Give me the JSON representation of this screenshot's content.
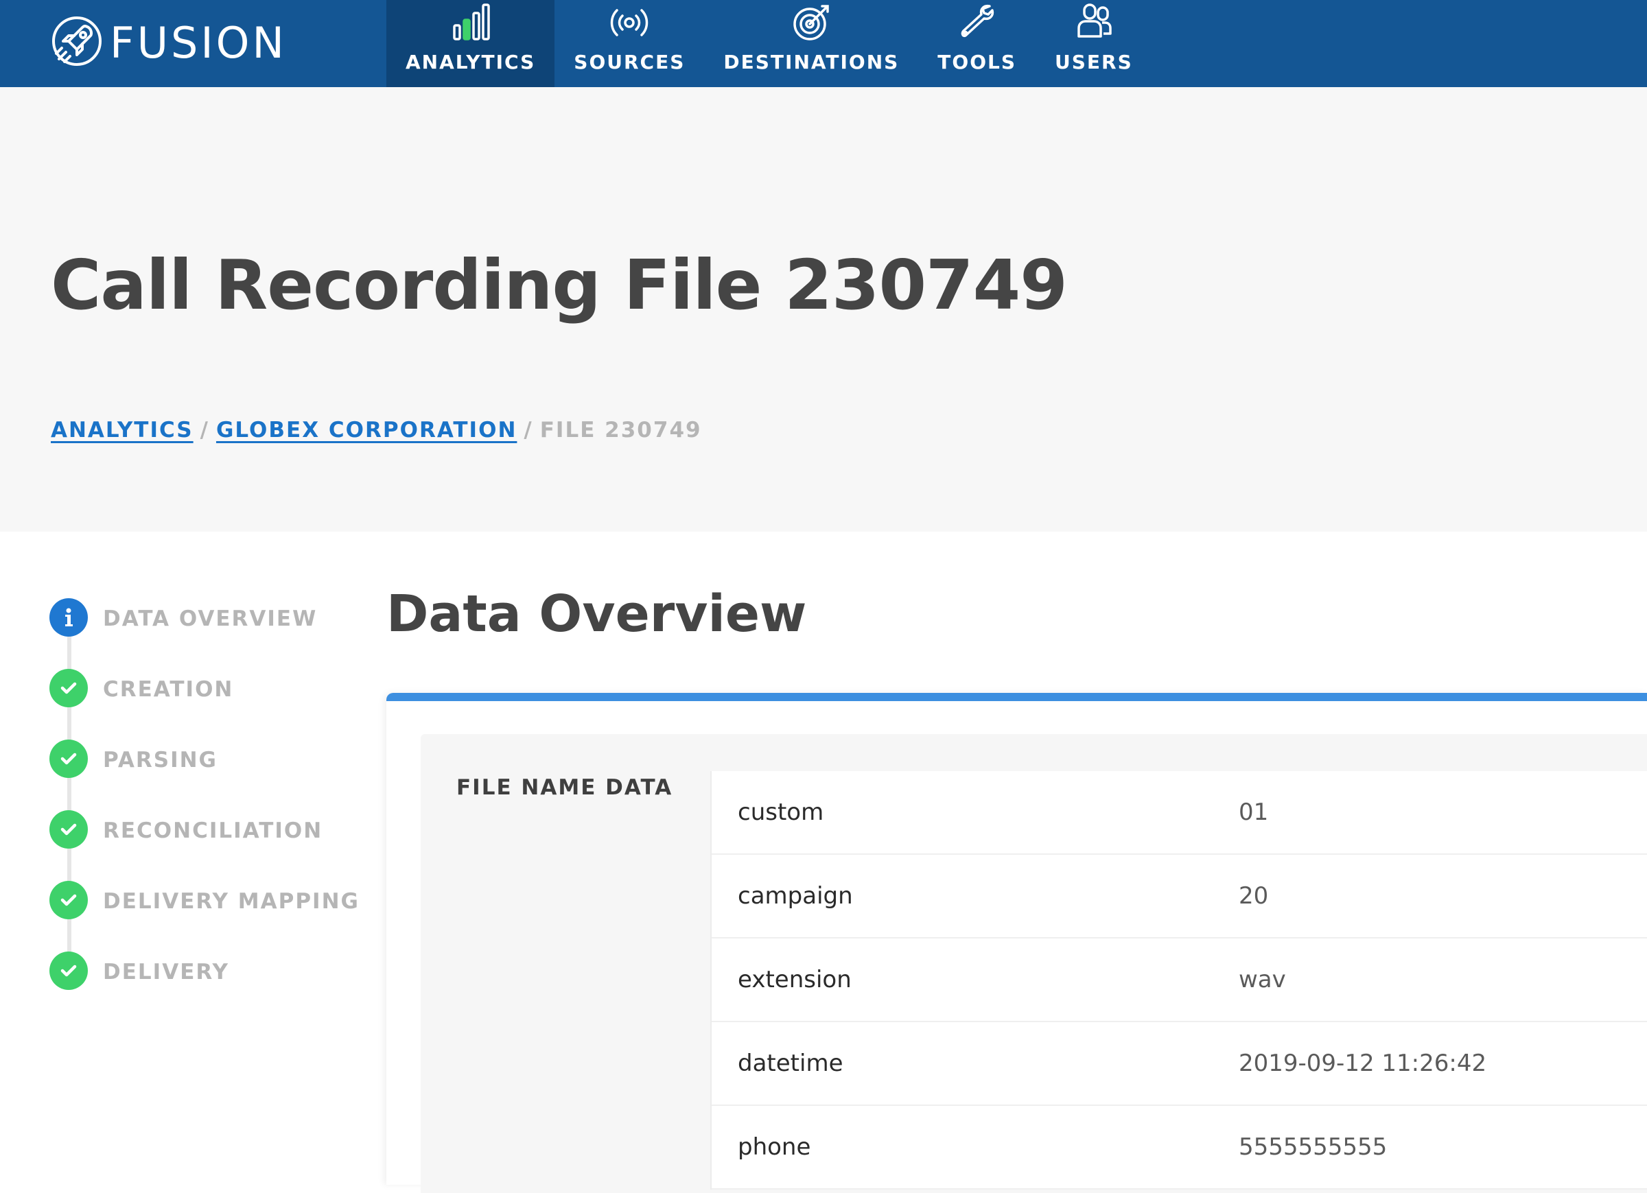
{
  "app": {
    "brand": "FUSION"
  },
  "nav": {
    "items": [
      {
        "label": "ANALYTICS",
        "icon": "bar-chart-icon",
        "active": true
      },
      {
        "label": "SOURCES",
        "icon": "broadcast-icon",
        "active": false
      },
      {
        "label": "DESTINATIONS",
        "icon": "target-icon",
        "active": false
      },
      {
        "label": "TOOLS",
        "icon": "wrench-icon",
        "active": false
      },
      {
        "label": "USERS",
        "icon": "users-icon",
        "active": false
      }
    ]
  },
  "header": {
    "title": "Call Recording File 230749",
    "breadcrumb": {
      "root": "ANALYTICS",
      "parent": "GLOBEX CORPORATION",
      "current": "FILE 230749",
      "separator": "/"
    }
  },
  "steps": [
    {
      "label": "DATA OVERVIEW",
      "status": "info"
    },
    {
      "label": "CREATION",
      "status": "done"
    },
    {
      "label": "PARSING",
      "status": "done"
    },
    {
      "label": "RECONCILIATION",
      "status": "done"
    },
    {
      "label": "DELIVERY MAPPING",
      "status": "done"
    },
    {
      "label": "DELIVERY",
      "status": "done"
    }
  ],
  "main": {
    "section_title": "Data Overview",
    "panel_label": "FILE NAME DATA",
    "rows": [
      {
        "key": "custom",
        "value": "01"
      },
      {
        "key": "campaign",
        "value": "20"
      },
      {
        "key": "extension",
        "value": "wav"
      },
      {
        "key": "datetime",
        "value": "2019-09-12 11:26:42"
      },
      {
        "key": "phone",
        "value": "5555555555"
      }
    ]
  },
  "colors": {
    "nav_bg": "#145694",
    "nav_active_bg": "#0e4477",
    "link": "#1a73c8",
    "info": "#1f78d1",
    "success": "#3ed16a",
    "card_accent": "#3d8fe0"
  }
}
